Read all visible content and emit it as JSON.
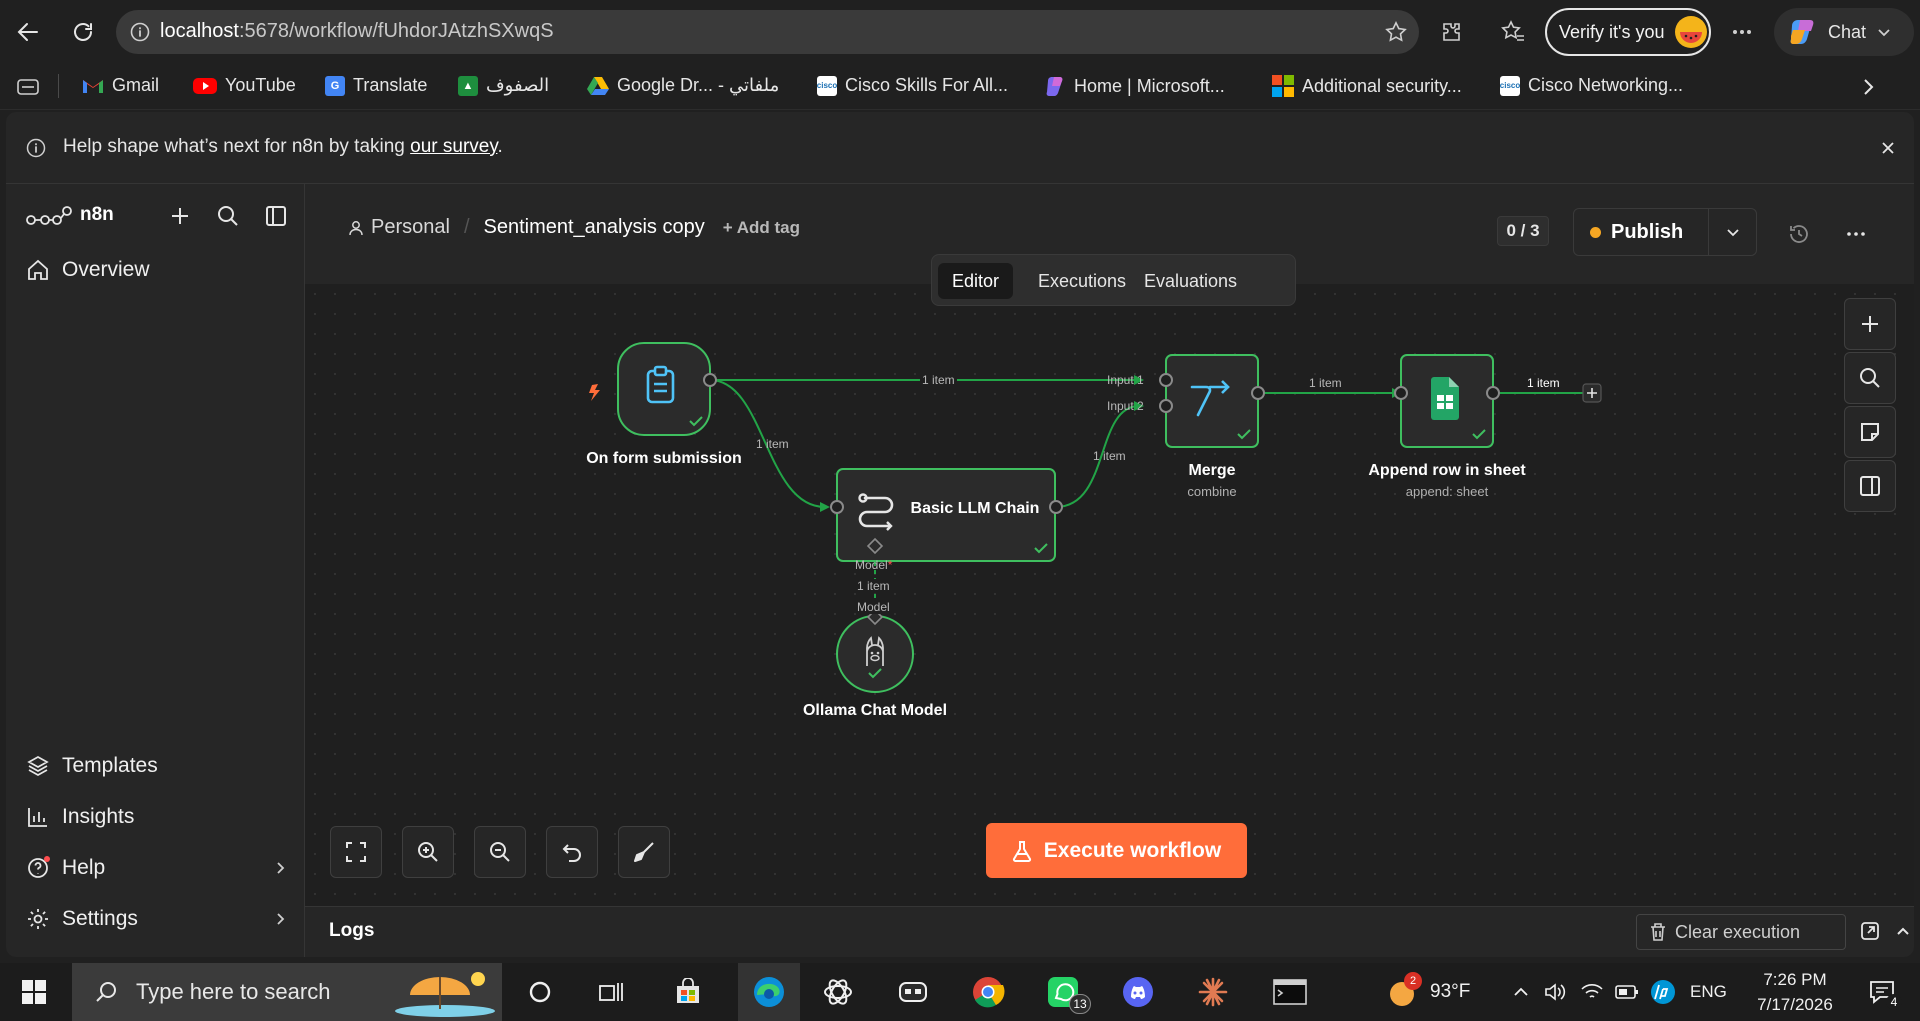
{
  "browser": {
    "url_host": "localhost",
    "url_path": ":5678/workflow/fUhdorJAtzhSXwqS",
    "verify_label": "Verify it's you",
    "chat_label": "Chat",
    "bookmarks": [
      {
        "label": "Gmail",
        "icon": "gmail-icon",
        "color": "#ea4335"
      },
      {
        "label": "YouTube",
        "icon": "youtube-icon",
        "color": "#ff0000"
      },
      {
        "label": "Translate",
        "icon": "translate-icon",
        "color": "#4285f4"
      },
      {
        "label": "الصفوف",
        "icon": "classroom-icon",
        "color": "#1e8e3e"
      },
      {
        "label": "Google Dr... - ملفاتي",
        "icon": "google-drive-icon",
        "color": "#fbbc04"
      },
      {
        "label": "Cisco Skills For All...",
        "icon": "cisco-icon",
        "color": "#ffffff"
      },
      {
        "label": "Home | Microsoft...",
        "icon": "microsoft-copilot-icon",
        "color": "#7b68ee"
      },
      {
        "label": "Additional security...",
        "icon": "microsoft-icon",
        "color": "#f25022"
      },
      {
        "label": "Cisco Networking...",
        "icon": "cisco-icon",
        "color": "#ffffff"
      }
    ]
  },
  "banner": {
    "text_before": "Help shape what’s next for n8n by taking ",
    "link": "our survey",
    "text_after": "."
  },
  "sidebar": {
    "logo": "n8n",
    "overview": "Overview",
    "bottom_items": [
      "Templates",
      "Insights",
      "Help",
      "Settings"
    ]
  },
  "header": {
    "project": "Personal",
    "separator": "/",
    "workflow_name": "Sentiment_analysis copy",
    "add_tag": "+ Add tag",
    "counter": "0 / 3",
    "publish": "Publish",
    "tabs": [
      "Editor",
      "Executions",
      "Evaluations"
    ],
    "active_tab": "Editor"
  },
  "nodes": {
    "form": {
      "label": "On form submission",
      "icon": "clipboard-icon"
    },
    "llm": {
      "label": "Basic LLM Chain",
      "icon": "chain-icon"
    },
    "merge": {
      "label": "Merge",
      "sub": "combine",
      "icon": "merge-icon"
    },
    "sheet": {
      "label": "Append row in sheet",
      "sub": "append: sheet",
      "icon": "google-sheets-icon"
    },
    "ollama": {
      "label": "Ollama Chat Model",
      "icon": "llama-icon"
    }
  },
  "edges": {
    "form_merge": "1 item",
    "form_llm": "1 item",
    "llm_merge": "1 item",
    "merge_sheet": "1 item",
    "sheet_out": "1 item",
    "model_item": "1 item",
    "input1": "Input 1",
    "input2": "Input 2",
    "model_top": "Model",
    "model_req": "*",
    "model_bottom": "Model"
  },
  "canvas": {
    "execute": "Execute workflow"
  },
  "logs": {
    "title": "Logs",
    "clear": "Clear execution"
  },
  "taskbar": {
    "search_placeholder": "Type here to search",
    "whatsapp_badge": "13",
    "weather_badge": "2",
    "temperature": "93°F",
    "language": "ENG",
    "time": "7:26 PM",
    "date": "7/17/2026",
    "notif_count": "4"
  },
  "colors": {
    "accent_orange": "#ff6d3a",
    "node_green": "#3fbf5f",
    "edge_green": "#22a447"
  }
}
